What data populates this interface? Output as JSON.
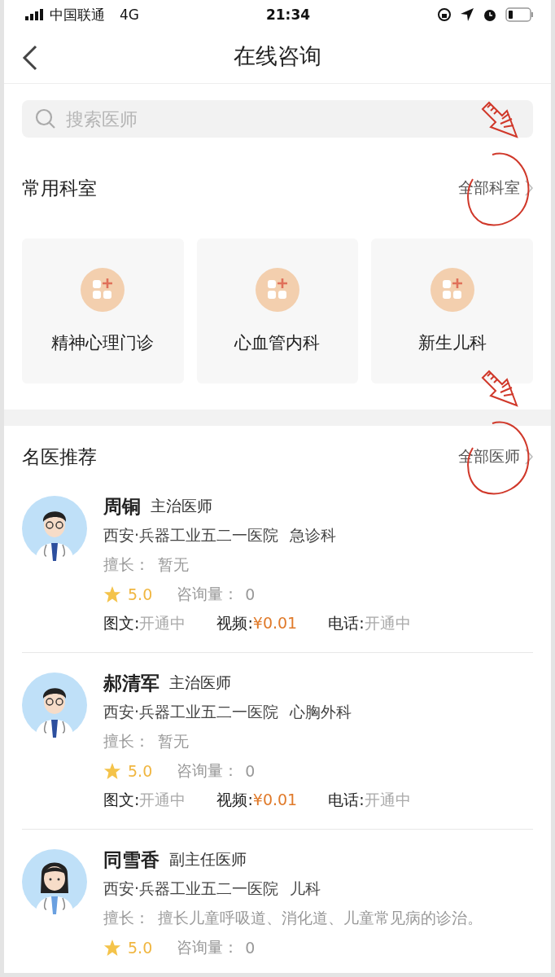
{
  "status_bar": {
    "carrier": "中国联通",
    "network": "4G",
    "time": "21:34"
  },
  "nav": {
    "title": "在线咨询"
  },
  "search": {
    "placeholder": "搜索医师"
  },
  "departments_section": {
    "title": "常用科室",
    "more": "全部科室",
    "annotated": true,
    "items": [
      {
        "name": "精神心理门诊"
      },
      {
        "name": "心血管内科"
      },
      {
        "name": "新生儿科"
      }
    ]
  },
  "doctors_section": {
    "title": "名医推荐",
    "more": "全部医师",
    "annotated": true,
    "doctors": [
      {
        "name": "周铜",
        "title": "主治医师",
        "hospital": "西安·兵器工业五二一医院",
        "department": "急诊科",
        "kind": "male",
        "specialty_label": "擅长：",
        "specialty": "暂无",
        "rating": "5.0",
        "consult_label": "咨询量：",
        "consult_count": "0",
        "services": [
          {
            "label": "图文:",
            "value": "开通中",
            "kind": "status"
          },
          {
            "label": "视频:",
            "value": "¥0.01",
            "kind": "price"
          },
          {
            "label": "电话:",
            "value": "开通中",
            "kind": "status"
          }
        ]
      },
      {
        "name": "郝清军",
        "title": "主治医师",
        "hospital": "西安·兵器工业五二一医院",
        "department": "心胸外科",
        "kind": "male",
        "specialty_label": "擅长：",
        "specialty": "暂无",
        "rating": "5.0",
        "consult_label": "咨询量：",
        "consult_count": "0",
        "services": [
          {
            "label": "图文:",
            "value": "开通中",
            "kind": "status"
          },
          {
            "label": "视频:",
            "value": "¥0.01",
            "kind": "price"
          },
          {
            "label": "电话:",
            "value": "开通中",
            "kind": "status"
          }
        ]
      },
      {
        "name": "同雪香",
        "title": "副主任医师",
        "hospital": "西安·兵器工业五二一医院",
        "department": "儿科",
        "kind": "female",
        "specialty_label": "擅长：",
        "specialty": "擅长儿童呼吸道、消化道、儿童常见病的诊治。",
        "rating": "5.0",
        "consult_label": "咨询量：",
        "consult_count": "0"
      }
    ]
  }
}
